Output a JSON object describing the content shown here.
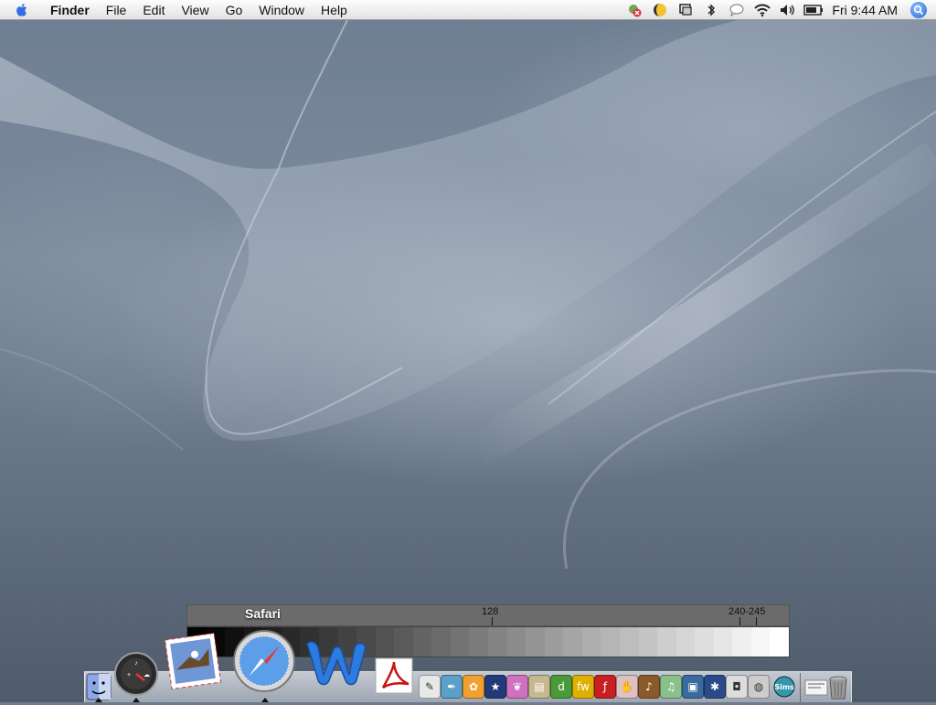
{
  "menubar": {
    "app_name": "Finder",
    "menus": [
      "File",
      "Edit",
      "View",
      "Go",
      "Window",
      "Help"
    ],
    "clock": "Fri 9:44 AM"
  },
  "gradient_panel": {
    "labels": [
      {
        "text": "128",
        "value": 128
      },
      {
        "text": "240-245",
        "value": 240
      }
    ],
    "ticks": [
      128,
      240,
      245
    ],
    "steps": 32
  },
  "dock": {
    "tooltip": "Safari",
    "sims_label": "Sims",
    "items": [
      "finder-icon",
      "dashboard-icon",
      "mail-icon",
      "safari-icon",
      "word-icon",
      "acrobat-icon",
      "text-edit-icon",
      "quill-icon",
      "flower-icon",
      "imovie-star-icon",
      "butterfly-icon",
      "preview-icon",
      "dreamweaver-icon",
      "fireworks-icon",
      "flash-icon",
      "hand-icon",
      "garageband-icon",
      "itunes-icon",
      "iphoto-icon",
      "final-cut-icon",
      "camera-icon",
      "disk-icon",
      "sims-icon",
      "documents-icon",
      "trash-icon"
    ]
  }
}
